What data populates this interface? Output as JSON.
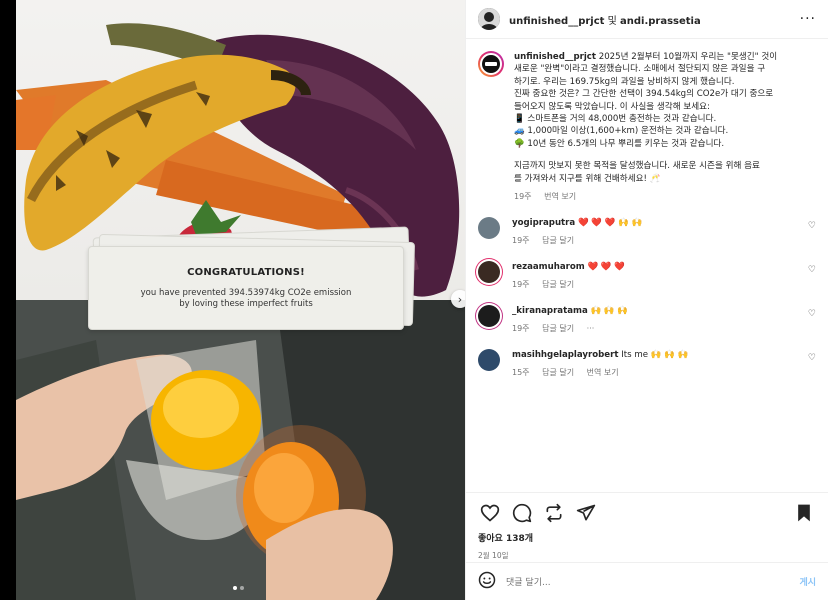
{
  "post": {
    "header": {
      "user": "unfinished__prjct",
      "sep": " 및 ",
      "collab": "andi.prassetia",
      "more": "···"
    },
    "card": {
      "title": "CONGRATULATIONS!",
      "body": "you have prevented 394.53974kg CO2e emission by loving these imperfect fruits"
    },
    "caption": {
      "user": "unfinished__prjct",
      "lines": [
        " 2025년 2월부터 10월까지 우리는 \"못생긴\" 것이",
        "새로운 \"완벽\"이라고 결정했습니다. 소매에서 절단되지 않은 과일을 구",
        "하기로. 우리는 169.75kg의 과일을 낭비하지 않게 했습니다.",
        "진짜 중요한 것은? 그 간단한 선택이 394.54kg의 CO2e가 대기 중으로",
        "들어오지 않도록 막았습니다. 이 사실을 생각해 보세요:",
        "📱 스마트폰을 거의 48,000번 충전하는 것과 같습니다.",
        "🚙 1,000마일 이상(1,600+km) 운전하는 것과 같습니다.",
        "🌳 10년 동안 6.5개의 나무 뿌리를 키우는 것과 같습니다.",
        "지금까지 맛보지 못한 목적을 달성했습니다. 새로운 시즌을 위해 음료",
        "를 가져와서 지구를 위해 건배하세요! 🥂"
      ],
      "time": "19주",
      "translate": "번역 보기"
    },
    "comments": [
      {
        "user": "yogipraputra",
        "text": "❤️ ❤️ ❤️ 🙌 🙌",
        "time": "19주",
        "reply": "답글 달기",
        "extra": "",
        "avatar_color": "#6b7b86"
      },
      {
        "user": "rezaamuharom",
        "text": "❤️ ❤️ ❤️",
        "time": "19주",
        "reply": "답글 달기",
        "extra": "",
        "avatar_color": "#3a2a22"
      },
      {
        "user": "_kiranapratama",
        "text": "🙌 🙌 🙌",
        "time": "19주",
        "reply": "답글 달기",
        "extra": "···",
        "avatar_color": "#1c1c1c"
      },
      {
        "user": "masihhgelaplayrobert",
        "text": "Its me 🙌 🙌 🙌",
        "time": "15주",
        "reply": "답글 달기",
        "extra": "번역 보기",
        "avatar_color": "#2e4a6a"
      }
    ],
    "likes": "좋아요 138개",
    "date": "2월 10일",
    "add_comment": {
      "placeholder": "댓글 달기...",
      "post_label": "게시"
    },
    "nav_arrow": "›",
    "colors": {
      "accent_blue": "#0095f6",
      "heart_red": "#ed2d52"
    }
  }
}
